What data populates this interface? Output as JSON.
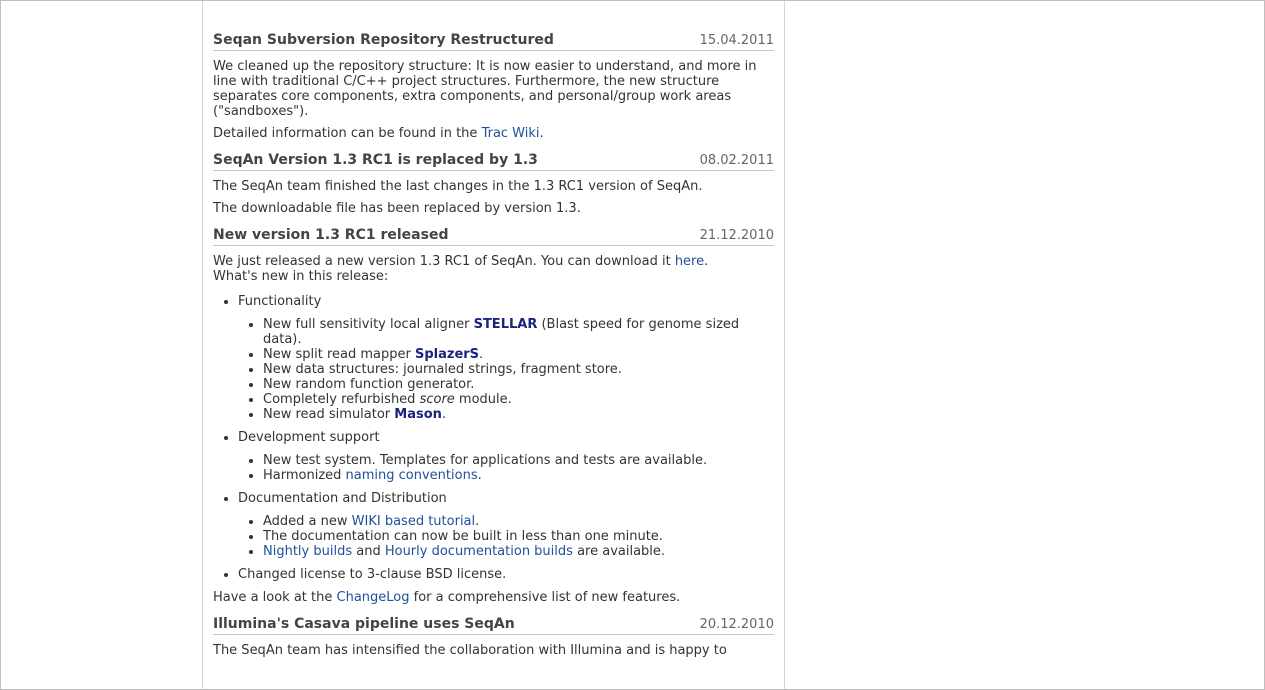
{
  "news": [
    {
      "title": "Seqan Subversion Repository Restructured",
      "date": "15.04.2011",
      "p1": "We cleaned up the repository structure: It is now easier to understand, and more in line with traditional C/C++ project structures. Furthermore, the new structure separates core components, extra components, and personal/group work areas (\"sandboxes\").",
      "p2_pre": "Detailed information can be found in the ",
      "p2_link": "Trac Wiki",
      "p2_post": "."
    },
    {
      "title": "SeqAn Version 1.3 RC1 is replaced by 1.3",
      "date": "08.02.2011",
      "p1": "The SeqAn team finished the last changes in the 1.3 RC1 version of SeqAn.",
      "p2": "The downloadable file has been replaced by version 1.3."
    },
    {
      "title": "New version 1.3 RC1 released",
      "date": "21.12.2010",
      "intro_pre": "We just released a new version 1.3 RC1 of SeqAn. You can download it ",
      "intro_link": "here",
      "intro_post": ".",
      "intro_line2": "What's new in this release:",
      "functionality": {
        "label": "Functionality",
        "i1_pre": "New full sensitivity local aligner ",
        "i1_link": "STELLAR",
        "i1_post": " (Blast speed for genome sized data).",
        "i2_pre": "New split read mapper ",
        "i2_link": "SplazerS",
        "i2_post": ".",
        "i3": "New data structures: journaled strings, fragment store.",
        "i4": "New random function generator.",
        "i5_pre": "Completely refurbished ",
        "i5_em": "score",
        "i5_post": " module.",
        "i6_pre": "New read simulator ",
        "i6_link": "Mason",
        "i6_post": "."
      },
      "development": {
        "label": "Development support",
        "i1": "New test system. Templates for applications and tests are available.",
        "i2_pre": "Harmonized ",
        "i2_link": "naming conventions",
        "i2_post": "."
      },
      "documentation": {
        "label": "Documentation and Distribution",
        "i1_pre": "Added a new ",
        "i1_link": "WIKI based tutorial",
        "i1_post": ".",
        "i2": "The documentation can now be built in less than one minute.",
        "i3_link1": "Nightly builds",
        "i3_mid": " and ",
        "i3_link2": "Hourly documentation builds",
        "i3_post": " are available."
      },
      "license": "Changed license to 3-clause BSD license.",
      "outro_pre": "Have a look at the ",
      "outro_link": "ChangeLog",
      "outro_post": " for a comprehensive list of new features."
    },
    {
      "title": "Illumina's Casava pipeline uses SeqAn",
      "date": "20.12.2010",
      "p1": "The SeqAn team has intensified the collaboration with Illumina and is happy to"
    }
  ]
}
